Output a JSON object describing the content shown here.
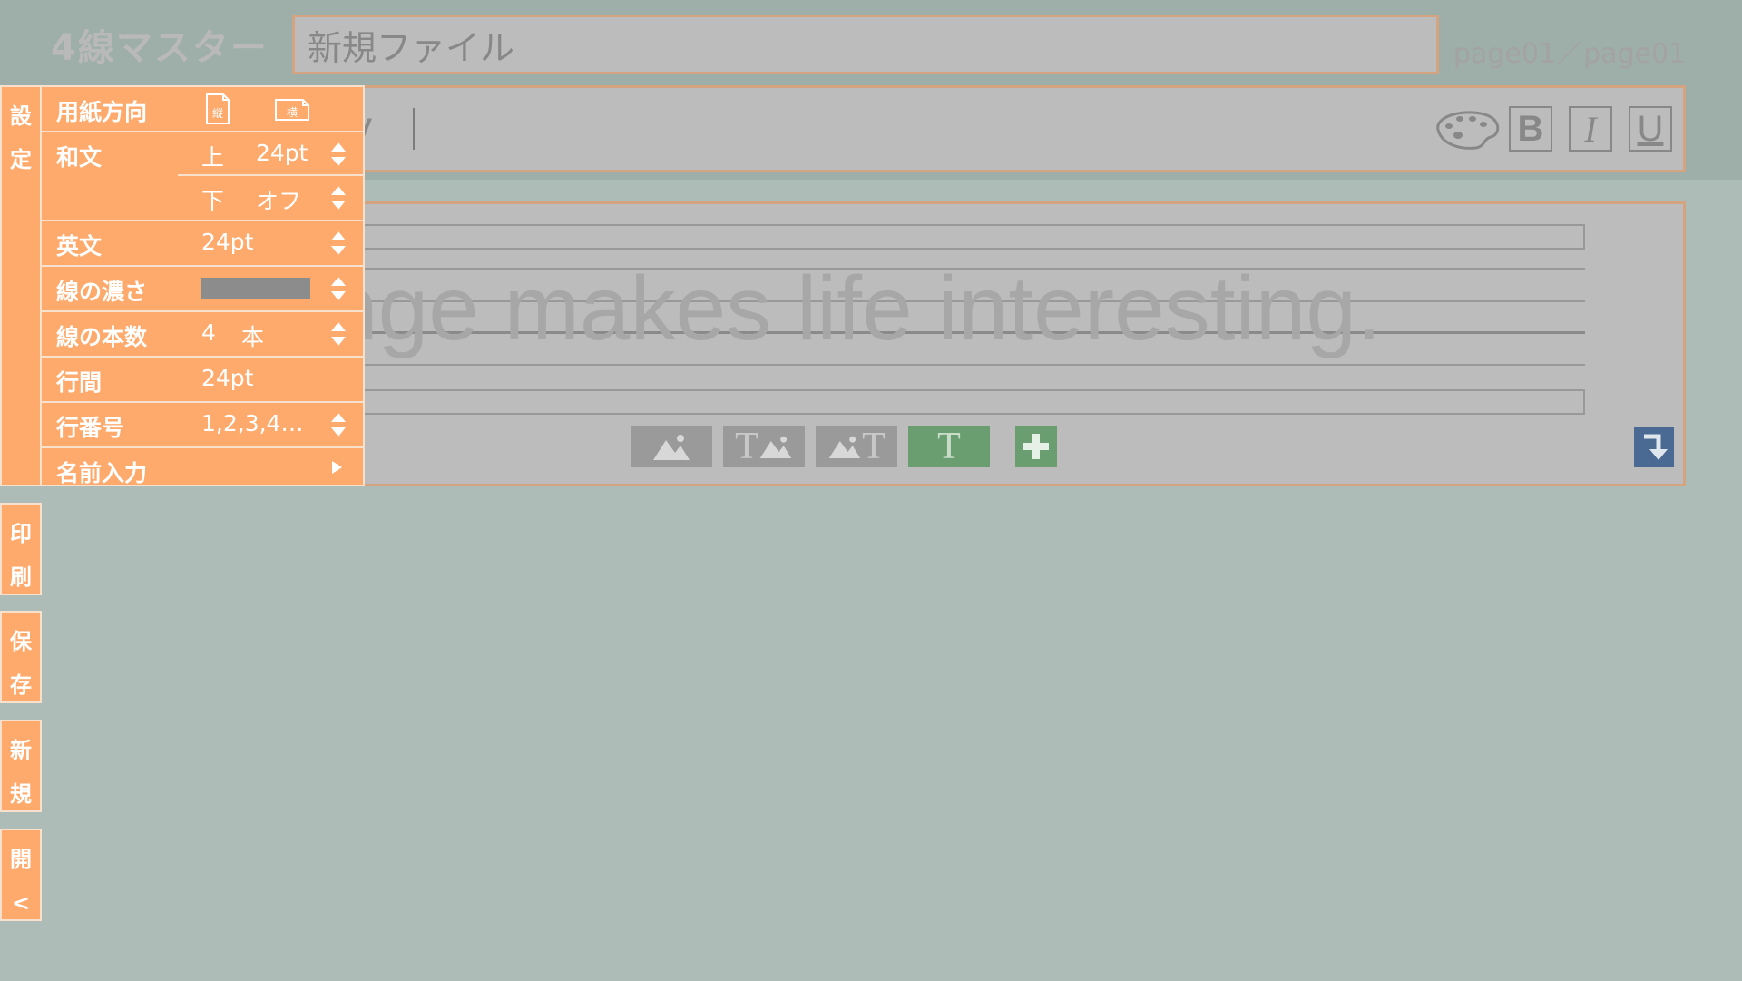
{
  "app": {
    "title": "4線マスター",
    "page_indicator": "page01／page01"
  },
  "file": {
    "name": "新規ファイル"
  },
  "textbar": {
    "text": "y"
  },
  "format": {
    "bold": "B",
    "italic": "I",
    "underline": "U"
  },
  "canvas": {
    "sample_text": "nge makes life interesting.",
    "tools": {
      "image_only": "image-icon",
      "text_image": "T",
      "image_text": "T",
      "text_only": "T"
    }
  },
  "side_tabs": {
    "settings": [
      "設",
      "定"
    ],
    "print": [
      "印",
      "刷"
    ],
    "save": [
      "保",
      "存"
    ],
    "new": [
      "新",
      "規"
    ],
    "open": [
      "開",
      "<"
    ]
  },
  "settings": {
    "orientation": {
      "label": "用紙方向",
      "portrait": "縦",
      "landscape": "横"
    },
    "japanese": {
      "label": "和文",
      "upper_pos": "上",
      "upper_value": "24pt",
      "lower_pos": "下",
      "lower_value": "オフ"
    },
    "english": {
      "label": "英文",
      "value": "24pt"
    },
    "line_density": {
      "label": "線の濃さ",
      "color": "#8c8c8c"
    },
    "line_count": {
      "label": "線の本数",
      "value": "4",
      "unit": "本"
    },
    "line_spacing": {
      "label": "行間",
      "value": "24pt"
    },
    "line_numbers": {
      "label": "行番号",
      "value": "1,2,3,4…"
    },
    "name_input": {
      "label": "名前入力"
    }
  },
  "colors": {
    "accent_orange": "#ffaa6d",
    "green_button": "#6a9e70",
    "blue_button": "#4b6a93",
    "background": "#adbcb6"
  }
}
